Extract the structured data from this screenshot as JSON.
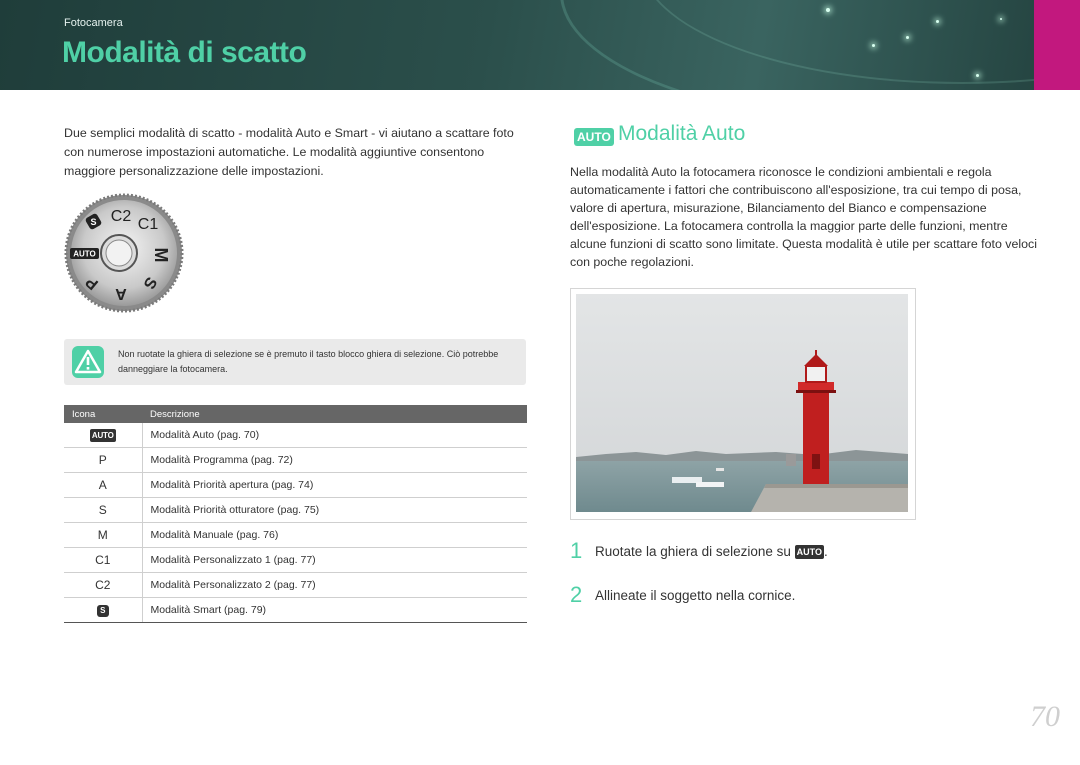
{
  "header": {
    "section_label": "Fotocamera",
    "title": "Modalità di scatto",
    "accent_color": "#4fd0a6",
    "tab_color": "#c2187e"
  },
  "intro": {
    "text": "Due semplici modalità di scatto - modalità Auto e Smart - vi aiutano a scattare foto con numerose impostazioni automatiche. Le modalità aggiuntive consentono maggiore personalizzazione delle impostazioni."
  },
  "dial": {
    "auto_label": "AUTO",
    "smart_label": "S",
    "labels": [
      "C2",
      "C1",
      "M",
      "S",
      "A",
      "P"
    ]
  },
  "warning": {
    "icon": "warning-icon",
    "text": "Non ruotate la ghiera di selezione se è premuto il tasto blocco ghiera di selezione. Ciò potrebbe danneggiare la fotocamera."
  },
  "table": {
    "col_icon": "Icona",
    "col_desc": "Descrizione",
    "rows": [
      {
        "icon": "AUTO",
        "desc": "Modalità Auto (pag. 70)"
      },
      {
        "icon": "P",
        "desc": "Modalità Programma (pag. 72)"
      },
      {
        "icon": "A",
        "desc": "Modalità Priorità apertura (pag. 74)"
      },
      {
        "icon": "S",
        "desc": "Modalità Priorità otturatore (pag. 75)"
      },
      {
        "icon": "M",
        "desc": "Modalità Manuale (pag. 76)"
      },
      {
        "icon": "C1",
        "desc": "Modalità Personalizzato 1 (pag. 77)"
      },
      {
        "icon": "C2",
        "desc": "Modalità Personalizzato 2 (pag. 77)"
      },
      {
        "icon": "S",
        "desc": "Modalità Smart (pag. 79)"
      }
    ]
  },
  "auto_section": {
    "badge": "AUTO",
    "heading": "Modalità Auto",
    "body": "Nella modalità Auto la fotocamera riconosce le condizioni ambientali e regola automaticamente i fattori che contribuiscono all'esposizione, tra cui tempo di posa, valore di apertura, misurazione, Bilanciamento del Bianco e compensazione dell'esposizione. La fotocamera controlla la maggior parte delle funzioni, mentre alcune funzioni di scatto sono limitate. Questa modalità è utile per scattare foto veloci con poche regolazioni."
  },
  "steps": [
    {
      "num": "1",
      "text": "Ruotate la ghiera di selezione su",
      "badge": "AUTO",
      "suffix": "."
    },
    {
      "num": "2",
      "text": "Allineate il soggetto nella cornice."
    }
  ],
  "page_number": "70"
}
